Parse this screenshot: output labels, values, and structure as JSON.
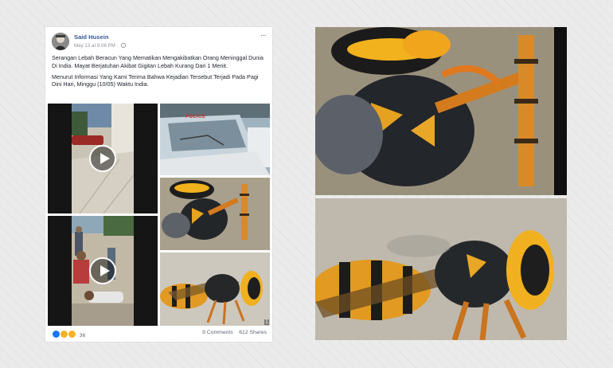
{
  "post": {
    "author": "Said Husein",
    "timestamp": "May 13 at 6:06 PM",
    "more_icon": "···",
    "paragraphs": [
      "Serangan Lebah Beracun Yang Mematikan Mengakibatkan Orang Meninggal Dunia Di India. Mayat Berjatuhan Akibat Gigitan Lebah Kurang Dari 1 Menit.",
      "Menurut Informasi Yang Kami Terima Bahwa Kejadian Tersebut Terjadi Pada Pagi Dini Hari, Minggu (10/05) Waktu India."
    ],
    "police_text": "POLICE",
    "more_photos_badge": "1"
  },
  "footer": {
    "reactions_count": "36",
    "comments": "9 Comments",
    "shares": "612 Shares"
  },
  "colors": {
    "author_link": "#385898",
    "like": "#1877f2",
    "sad": "#f7b125",
    "wow": "#f7b125"
  },
  "icons": [
    "globe-icon",
    "more-icon",
    "play-icon",
    "like-reaction-icon",
    "sad-reaction-icon",
    "wow-reaction-icon"
  ]
}
